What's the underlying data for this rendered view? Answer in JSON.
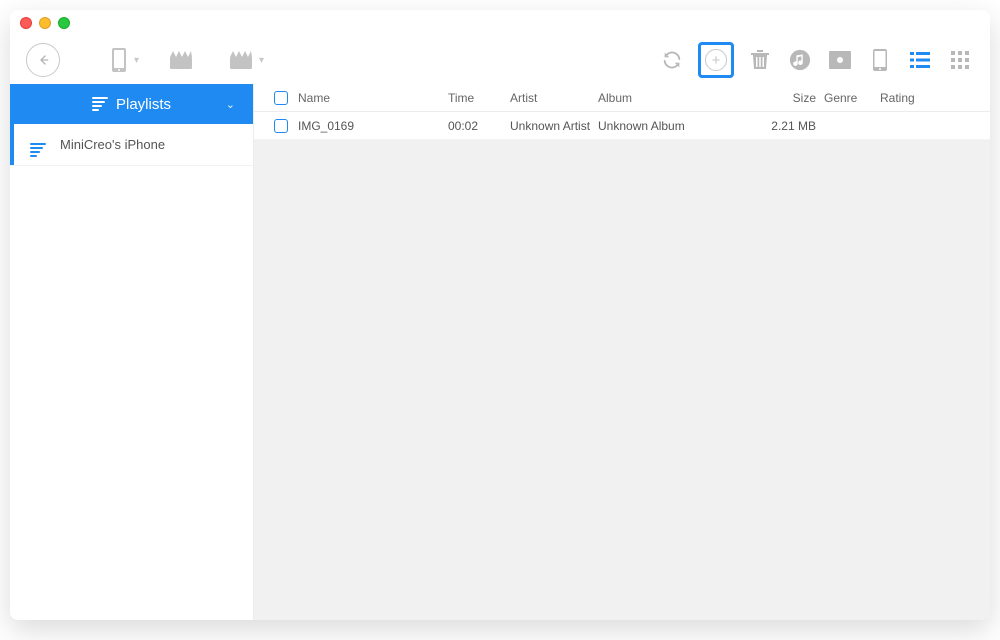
{
  "sidebar": {
    "header_label": "Playlists",
    "items": [
      {
        "label": "MiniCreo's iPhone"
      }
    ]
  },
  "table": {
    "headers": {
      "name": "Name",
      "time": "Time",
      "artist": "Artist",
      "album": "Album",
      "size": "Size",
      "genre": "Genre",
      "rating": "Rating"
    },
    "rows": [
      {
        "name": "IMG_0169",
        "time": "00:02",
        "artist": "Unknown Artist",
        "album": "Unknown Album",
        "size": "2.21 MB",
        "genre": "",
        "rating": ""
      }
    ]
  }
}
